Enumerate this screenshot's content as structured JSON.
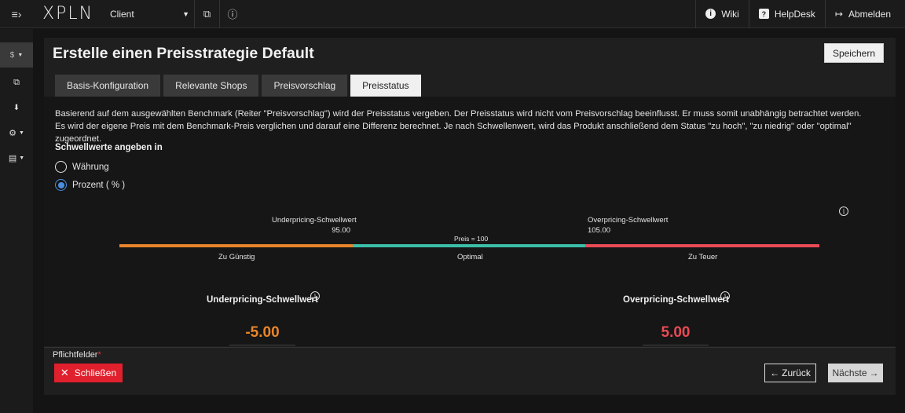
{
  "topbar": {
    "logo": "XPLN",
    "client_label": "Client",
    "wiki": "Wiki",
    "helpdesk": "HelpDesk",
    "logout": "Abmelden"
  },
  "sidebar": {
    "items": [
      {
        "icon": "dollar-icon",
        "glyph": "$"
      },
      {
        "icon": "copy-icon",
        "glyph": "⧉"
      },
      {
        "icon": "download-icon",
        "glyph": "⬇"
      },
      {
        "icon": "gear-icon",
        "glyph": "⚙"
      },
      {
        "icon": "card-icon",
        "glyph": "▤"
      }
    ]
  },
  "page": {
    "title": "Erstelle einen Preisstrategie Default",
    "save_label": "Speichern"
  },
  "tabs": [
    {
      "label": "Basis-Konfiguration"
    },
    {
      "label": "Relevante Shops"
    },
    {
      "label": "Preisvorschlag"
    },
    {
      "label": "Preisstatus"
    }
  ],
  "content": {
    "description": "Basierend auf dem ausgewählten Benchmark (Reiter \"Preisvorschlag\") wird der Preisstatus vergeben. Der Preisstatus wird nicht vom Preisvorschlag beeinflusst. Er muss somit unabhängig betrachtet werden. Es wird der eigene Preis mit dem Benchmark-Preis verglichen und darauf eine Differenz berechnet. Je nach Schwellenwert, wird das Produkt anschließend dem Status \"zu hoch\", \"zu niedrig\" oder \"optimal\" zugeordnet.",
    "threshold_label": "Schwellwerte angeben in",
    "options": [
      {
        "label": "Währung",
        "checked": false
      },
      {
        "label": "Prozent ( % )",
        "checked": true
      }
    ],
    "scale": {
      "under_label": "Underpricing-Schwellwert",
      "under_value": "95.00",
      "over_label": "Overpricing-Schwellwert",
      "over_value": "105.00",
      "price_label": "Preis = 100",
      "segments": [
        {
          "label": "Zu Günstig",
          "color": "#e8852a"
        },
        {
          "label": "Optimal",
          "color": "#3cbfaa"
        },
        {
          "label": "Zu Teuer",
          "color": "#ea4a55"
        }
      ]
    },
    "under_field": {
      "label": "Underpricing-Schwellwert",
      "value": "-5.00",
      "color": "#e8852a"
    },
    "over_field": {
      "label": "Overpricing-Schwellwert",
      "value": "5.00",
      "color": "#ea4a55"
    }
  },
  "footer": {
    "required": "Pflichtfelder",
    "required_mark": "*",
    "close": "Schließen",
    "back": "Zurück",
    "next": "Nächste"
  }
}
